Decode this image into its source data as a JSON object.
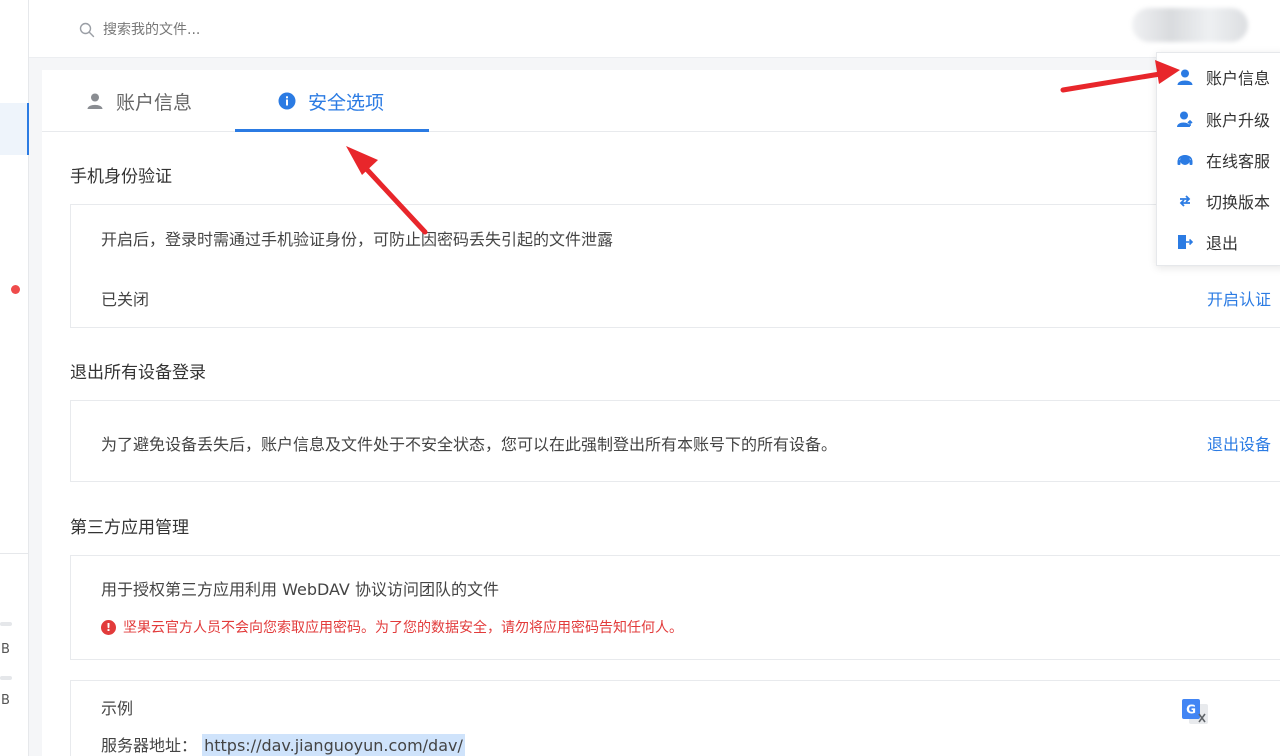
{
  "search": {
    "placeholder": "搜索我的文件..."
  },
  "tabs": [
    {
      "label": "账户信息"
    },
    {
      "label": "安全选项"
    }
  ],
  "sections": {
    "phone_auth": {
      "title": "手机身份验证",
      "description": "开启后，登录时需通过手机验证身份，可防止因密码丢失引起的文件泄露",
      "status": "已关闭",
      "action": "开启认证"
    },
    "logout_devices": {
      "title": "退出所有设备登录",
      "description": "为了避免设备丢失后，账户信息及文件处于不安全状态，您可以在此强制登出所有本账号下的所有设备。",
      "action": "退出设备"
    },
    "third_party": {
      "title": "第三方应用管理",
      "description": "用于授权第三方应用利用 WebDAV 协议访问团队的文件",
      "warning": "坚果云官方人员不会向您索取应用密码。为了您的数据安全，请勿将应用密码告知任何人。"
    },
    "example": {
      "title": "示例",
      "server_label": "服务器地址：",
      "server_url": "https://dav.jianguoyun.com/dav/"
    }
  },
  "dropdown": {
    "items": [
      {
        "label": "账户信息",
        "icon": "user-icon"
      },
      {
        "label": "账户升级",
        "icon": "user-upgrade-icon"
      },
      {
        "label": "在线客服",
        "icon": "headset-icon"
      },
      {
        "label": "切换版本",
        "icon": "switch-icon"
      },
      {
        "label": "退出",
        "icon": "logout-icon"
      }
    ]
  },
  "rail": {
    "label_1": "B",
    "label_2": "B"
  },
  "colors": {
    "accent": "#2b7be3",
    "warning": "#e23b3b",
    "arrow": "#e8262b"
  }
}
